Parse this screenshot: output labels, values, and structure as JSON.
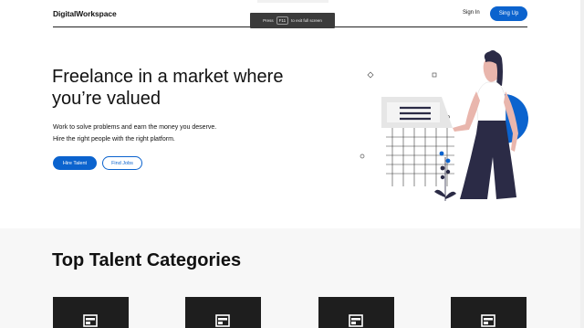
{
  "header": {
    "logo": "DigitalWorkspace",
    "signin_label": "Sign In",
    "signup_label": "Sing Up"
  },
  "fullscreen_notice": {
    "prefix": "Press",
    "key": "F11",
    "suffix": "to exit full screen"
  },
  "hero": {
    "headline": "Freelance in a market where you’re valued",
    "sub_line1": "Work to solve problems and earn the money you deserve.",
    "sub_line2": "Hire the right people with the right platform.",
    "hire_label": "Hire Talent",
    "find_label": "Find Jobs"
  },
  "categories": {
    "title": "Top Talent Categories",
    "cards": 4
  },
  "colors": {
    "accent": "#0b63ce",
    "section_bg": "#f7f7f7",
    "card_bg": "#1e1e1e"
  }
}
